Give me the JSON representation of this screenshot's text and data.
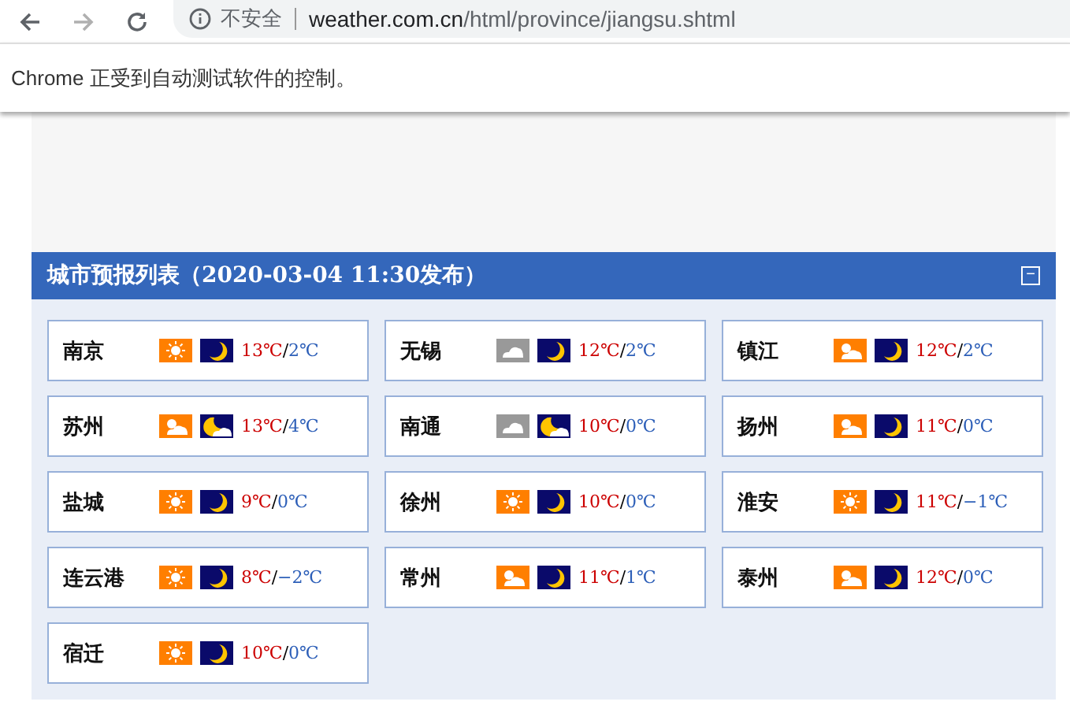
{
  "browser": {
    "security_label": "不安全",
    "url_host": "weather.com.cn",
    "url_path": "/html/province/jiangsu.shtml"
  },
  "infobar": {
    "text": "Chrome 正受到自动测试软件的控制。"
  },
  "panel": {
    "title": "城市预报列表（2020-03-04 11:30发布）",
    "collapse_symbol": "−",
    "cities": [
      {
        "name": "南京",
        "day_icon": {
          "kind": "sunny"
        },
        "night_icon": {
          "kind": "moon"
        },
        "high": "13℃",
        "sep": "/",
        "low": "2℃"
      },
      {
        "name": "无锡",
        "day_icon": {
          "kind": "overcast"
        },
        "night_icon": {
          "kind": "moon"
        },
        "high": "12℃",
        "sep": "/",
        "low": "2℃"
      },
      {
        "name": "镇江",
        "day_icon": {
          "kind": "partly"
        },
        "night_icon": {
          "kind": "moon"
        },
        "high": "12℃",
        "sep": "/",
        "low": "2℃"
      },
      {
        "name": "苏州",
        "day_icon": {
          "kind": "partly"
        },
        "night_icon": {
          "kind": "cloudy"
        },
        "high": "13℃",
        "sep": "/",
        "low": "4℃"
      },
      {
        "name": "南通",
        "day_icon": {
          "kind": "overcast"
        },
        "night_icon": {
          "kind": "cloudy"
        },
        "high": "10℃",
        "sep": "/",
        "low": "0℃"
      },
      {
        "name": "扬州",
        "day_icon": {
          "kind": "partly"
        },
        "night_icon": {
          "kind": "moon"
        },
        "high": "11℃",
        "sep": "/",
        "low": "0℃"
      },
      {
        "name": "盐城",
        "day_icon": {
          "kind": "sunny"
        },
        "night_icon": {
          "kind": "moon"
        },
        "high": "9℃",
        "sep": "/",
        "low": "0℃"
      },
      {
        "name": "徐州",
        "day_icon": {
          "kind": "sunny"
        },
        "night_icon": {
          "kind": "moon"
        },
        "high": "10℃",
        "sep": "/",
        "low": "0℃"
      },
      {
        "name": "淮安",
        "day_icon": {
          "kind": "sunny"
        },
        "night_icon": {
          "kind": "moon"
        },
        "high": "11℃",
        "sep": "/",
        "low": "−1℃"
      },
      {
        "name": "连云港",
        "day_icon": {
          "kind": "sunny"
        },
        "night_icon": {
          "kind": "moon"
        },
        "high": "8℃",
        "sep": "/",
        "low": "−2℃"
      },
      {
        "name": "常州",
        "day_icon": {
          "kind": "partly"
        },
        "night_icon": {
          "kind": "moon"
        },
        "high": "11℃",
        "sep": "/",
        "low": "1℃"
      },
      {
        "name": "泰州",
        "day_icon": {
          "kind": "partly"
        },
        "night_icon": {
          "kind": "moon"
        },
        "high": "12℃",
        "sep": "/",
        "low": "0℃"
      },
      {
        "name": "宿迁",
        "day_icon": {
          "kind": "sunny"
        },
        "night_icon": {
          "kind": "moon"
        },
        "high": "10℃",
        "sep": "/",
        "low": "0℃"
      }
    ]
  }
}
